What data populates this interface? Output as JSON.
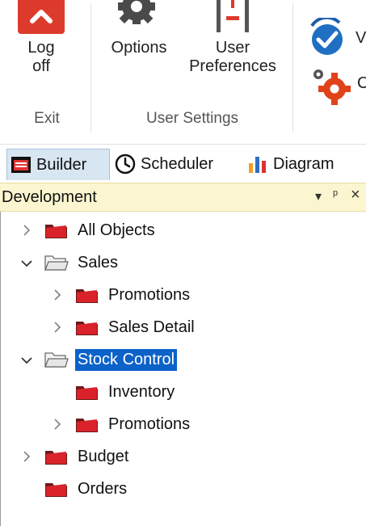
{
  "ribbon": {
    "buttons": [
      {
        "id": "log-off",
        "label": "Log\noff"
      },
      {
        "id": "options",
        "label": "Options"
      },
      {
        "id": "user-preferences",
        "label": "User\nPreferences"
      }
    ],
    "groups": [
      {
        "label": "Exit"
      },
      {
        "label": "User Settings"
      }
    ],
    "right_partial": {
      "top_char": "V",
      "bottom_char": "C"
    }
  },
  "tabs": [
    {
      "label": "Builder",
      "icon": "builder-icon",
      "active": true
    },
    {
      "label": "Scheduler",
      "icon": "clock-icon",
      "active": false
    },
    {
      "label": "Diagram",
      "icon": "bar-chart-icon",
      "active": false
    }
  ],
  "panel": {
    "title": "Development",
    "controls": {
      "dropdown": "▾",
      "pin": "ᵖ",
      "close": "×"
    }
  },
  "tree": [
    {
      "label": "All Objects",
      "level": 0,
      "expander": "collapsed",
      "folder": "red"
    },
    {
      "label": "Sales",
      "level": 0,
      "expander": "expanded",
      "folder": "open"
    },
    {
      "label": "Promotions",
      "level": 1,
      "expander": "collapsed",
      "folder": "red"
    },
    {
      "label": "Sales Detail",
      "level": 1,
      "expander": "collapsed",
      "folder": "red"
    },
    {
      "label": "Stock Control",
      "level": 0,
      "expander": "expanded",
      "folder": "open",
      "selected": true
    },
    {
      "label": "Inventory",
      "level": 1,
      "expander": "none",
      "folder": "red"
    },
    {
      "label": "Promotions",
      "level": 1,
      "expander": "collapsed",
      "folder": "red"
    },
    {
      "label": "Budget",
      "level": 0,
      "expander": "collapsed",
      "folder": "red"
    },
    {
      "label": "Orders",
      "level": 0,
      "expander": "none",
      "folder": "red"
    }
  ],
  "colors": {
    "accent": "#0b62c9",
    "panel_header": "#fcf6d0",
    "folder_red": "#d9222a"
  }
}
